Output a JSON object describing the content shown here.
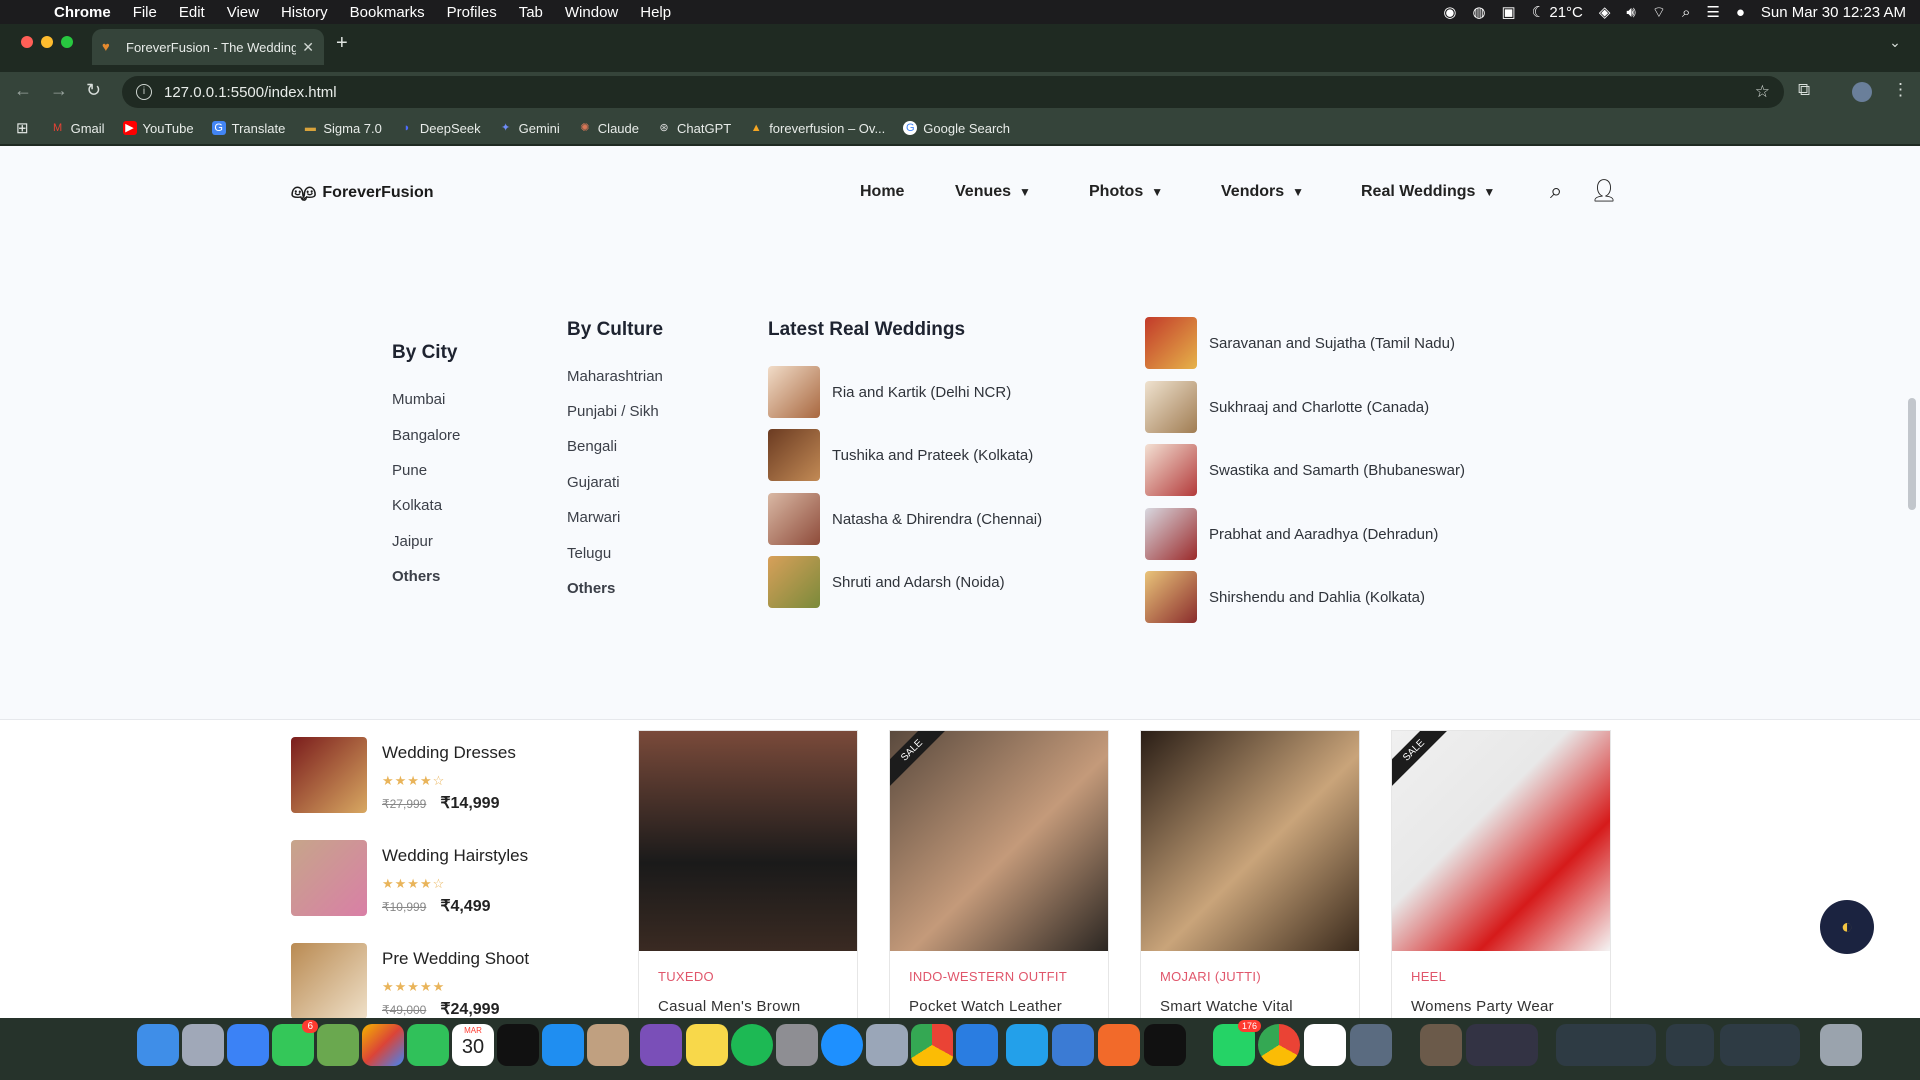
{
  "menubar": {
    "app": "Chrome",
    "items": [
      "File",
      "Edit",
      "View",
      "History",
      "Bookmarks",
      "Profiles",
      "Tab",
      "Window",
      "Help"
    ],
    "temp": "21°C",
    "datetime": "Sun Mar 30  12:23 AM"
  },
  "tab": {
    "title": "ForeverFusion - The Wedding"
  },
  "address": {
    "url": "127.0.0.1:5500/index.html"
  },
  "bookmarks": [
    {
      "label": "Gmail",
      "color": "#ea4335"
    },
    {
      "label": "YouTube",
      "color": "#ff0000"
    },
    {
      "label": "Translate",
      "color": "#4285f4"
    },
    {
      "label": "Sigma 7.0",
      "color": "#d9a33b"
    },
    {
      "label": "DeepSeek",
      "color": "#4d6bfe"
    },
    {
      "label": "Gemini",
      "color": "#6f8cf7"
    },
    {
      "label": "Claude",
      "color": "#d97757"
    },
    {
      "label": "ChatGPT",
      "color": "#aaaaaa"
    },
    {
      "label": "foreverfusion – Ov...",
      "color": "#f5a623"
    },
    {
      "label": "Google Search",
      "color": "#4285f4"
    }
  ],
  "site": {
    "brand": "ForeverFusion",
    "nav": [
      "Home",
      "Venues",
      "Photos",
      "Vendors",
      "Real Weddings"
    ]
  },
  "mega": {
    "city": {
      "heading": "By City",
      "items": [
        "Mumbai",
        "Bangalore",
        "Pune",
        "Kolkata",
        "Jaipur"
      ],
      "others": "Others"
    },
    "culture": {
      "heading": "By Culture",
      "items": [
        "Maharashtrian",
        "Punjabi / Sikh",
        "Bengali",
        "Gujarati",
        "Marwari",
        "Telugu"
      ],
      "others": "Others"
    },
    "latest": {
      "heading": "Latest Real Weddings",
      "left": [
        "Ria and Kartik (Delhi NCR)",
        "Tushika and Prateek (Kolkata)",
        "Natasha & Dhirendra (Chennai)",
        "Shruti and Adarsh (Noida)"
      ],
      "right": [
        "Saravanan and Sujatha (Tamil Nadu)",
        "Sukhraaj and Charlotte (Canada)",
        "Swastika and Samarth (Bhubaneswar)",
        "Prabhat and Aaradhya (Dehradun)",
        "Shirshendu and Dahlia (Kolkata)"
      ]
    }
  },
  "products": [
    {
      "name": "Wedding Dresses",
      "stars": "★★★★☆",
      "old": "₹27,999",
      "price": "₹14,999"
    },
    {
      "name": "Wedding Hairstyles",
      "stars": "★★★★☆",
      "old": "₹10,999",
      "price": "₹4,499"
    },
    {
      "name": "Pre Wedding Shoot",
      "stars": "★★★★★",
      "old": "₹49,000",
      "price": "₹24,999"
    }
  ],
  "cards": [
    {
      "cat": "TUXEDO",
      "name": "Casual Men's Brown",
      "sale": ""
    },
    {
      "cat": "INDO-WESTERN OUTFIT",
      "name": "Pocket Watch Leather",
      "sale": "SALE"
    },
    {
      "cat": "MOJARI (JUTTI)",
      "name": "Smart Watche Vital",
      "sale": ""
    },
    {
      "cat": "HEEL",
      "name": "Womens Party Wear",
      "sale": "SALE"
    }
  ],
  "dock": {
    "calendar_month": "MAR",
    "calendar_day": "30",
    "messages_badge": "6",
    "whatsapp_badge": "176"
  }
}
